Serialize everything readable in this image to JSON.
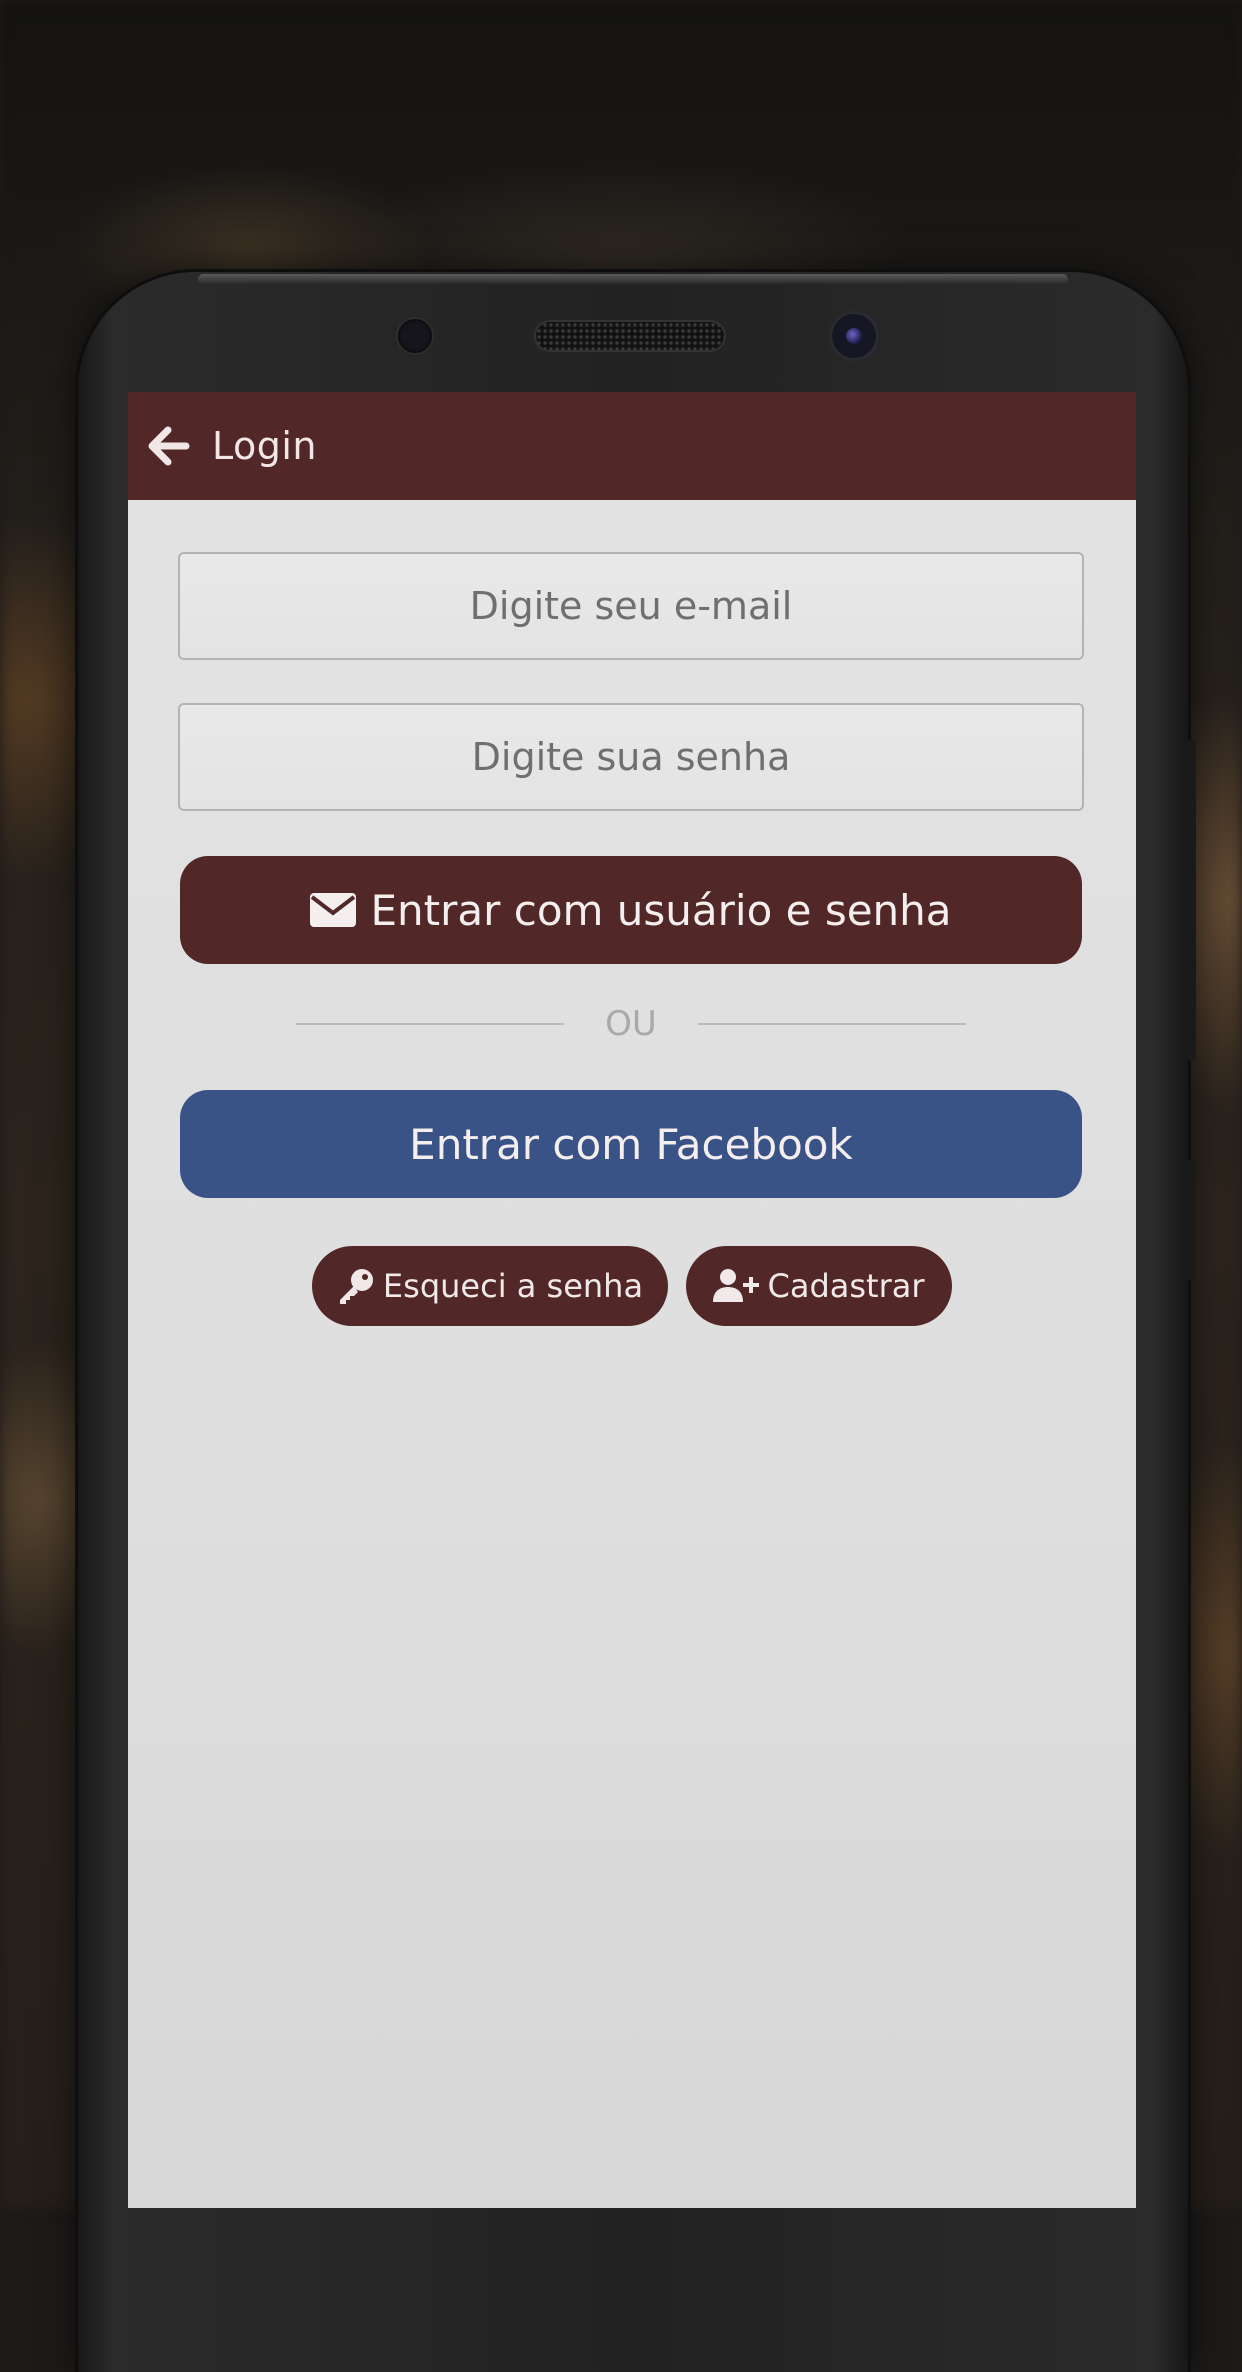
{
  "appbar": {
    "title": "Login",
    "back_icon": "arrow-left-icon",
    "background": "#512827"
  },
  "form": {
    "email": {
      "placeholder": "Digite seu e-mail",
      "value": ""
    },
    "password": {
      "placeholder": "Digite sua senha",
      "value": ""
    }
  },
  "buttons": {
    "login": {
      "label": "Entrar com usuário e senha",
      "icon": "envelope-icon",
      "color": "#512827"
    },
    "divider_text": "OU",
    "facebook": {
      "label": "Entrar com Facebook",
      "color": "#3a5386"
    },
    "forgot_password": {
      "label": "Esqueci a senha",
      "icon": "key-icon"
    },
    "register": {
      "label": "Cadastrar",
      "icon": "user-plus-icon"
    }
  }
}
